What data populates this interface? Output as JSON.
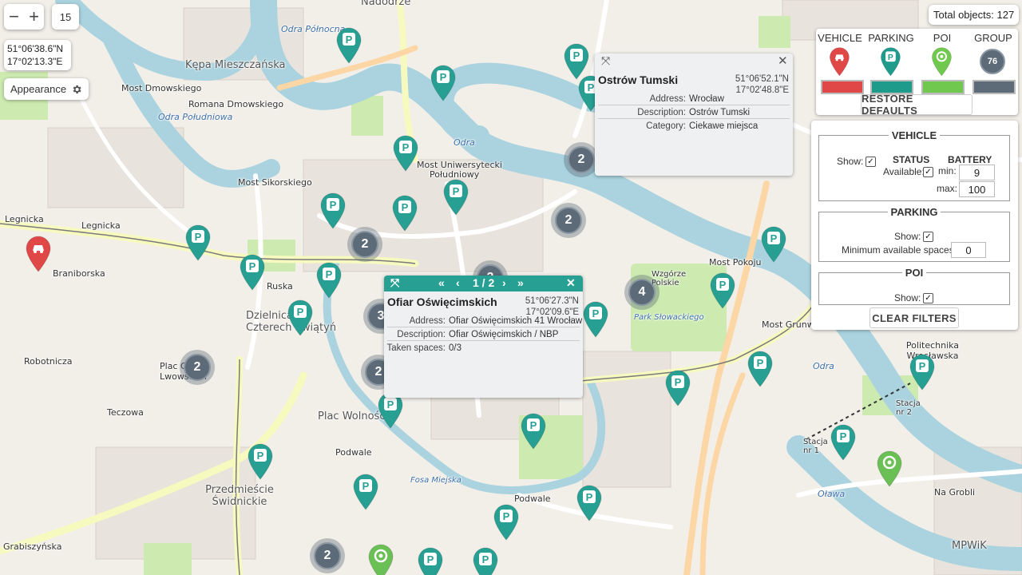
{
  "map": {
    "labels": [
      {
        "text": "Nadodrze",
        "cls": "big"
      },
      {
        "text": "Kępa Mieszczańska",
        "cls": "big"
      },
      {
        "text": "Most Dmowskiego",
        "cls": ""
      },
      {
        "text": "Romana Dmowskiego",
        "cls": ""
      },
      {
        "text": "Most Sikorskiego",
        "cls": ""
      },
      {
        "text": "Most Uniwersytecki",
        "cls": ""
      },
      {
        "text": "Południowy",
        "cls": ""
      },
      {
        "text": "Legnicka",
        "cls": ""
      },
      {
        "text": "Legnicka",
        "cls": ""
      },
      {
        "text": "Braniborska",
        "cls": ""
      },
      {
        "text": "Ruska",
        "cls": ""
      },
      {
        "text": "Dzielnica Czterech Świątyń",
        "cls": "big"
      },
      {
        "text": "Plac Orląt Lwowskich",
        "cls": ""
      },
      {
        "text": "Plac Wolności",
        "cls": "big"
      },
      {
        "text": "Przedmieście Świdnickie",
        "cls": "big"
      },
      {
        "text": "Most Pokoju",
        "cls": ""
      },
      {
        "text": "Most Grunwaldzki",
        "cls": ""
      },
      {
        "text": "Politechnika Wrocławska",
        "cls": ""
      },
      {
        "text": "Wzgórze Polskie",
        "cls": ""
      },
      {
        "text": "Park Słowackiego",
        "cls": "water"
      },
      {
        "text": "Odra",
        "cls": "water"
      },
      {
        "text": "Odra",
        "cls": "water"
      },
      {
        "text": "Odra Południowa",
        "cls": "water"
      },
      {
        "text": "Odra Północna",
        "cls": "water"
      },
      {
        "text": "Fosa Miejska",
        "cls": "water"
      },
      {
        "text": "Oława",
        "cls": "water"
      },
      {
        "text": "Na Grobli",
        "cls": ""
      },
      {
        "text": "Stacja nr 1",
        "cls": ""
      },
      {
        "text": "Stacja nr 2",
        "cls": ""
      },
      {
        "text": "MPWiK",
        "cls": "big"
      },
      {
        "text": "Grabiszyńska",
        "cls": ""
      },
      {
        "text": "Podwale",
        "cls": ""
      },
      {
        "text": "Podwale",
        "cls": ""
      },
      {
        "text": "Teczowa",
        "cls": ""
      },
      {
        "text": "Robotnicza",
        "cls": ""
      }
    ],
    "clusters": [
      "2",
      "2",
      "2",
      "2",
      "4",
      "2",
      "2",
      "2",
      "3"
    ],
    "colors": {
      "parking": "#27a093",
      "poi": "#6abf55",
      "vehicle": "#e04848",
      "group": "#5d6b78"
    }
  },
  "controls": {
    "zoom_out": "−",
    "zoom_in": "+",
    "zoom_level": "15",
    "coord_lat": "51°06'38.6\"N",
    "coord_lon": "17°02'13.3\"E",
    "appearance_label": "Appearance",
    "appearance_icon": "gear-icon",
    "total_objects": "Total objects: 127"
  },
  "legend": {
    "vehicle": "VEHICLE",
    "parking": "PARKING",
    "poi": "POI",
    "group": "GROUP",
    "group_count": "76",
    "colors": {
      "vehicle": "#e04848",
      "parking": "#1f9b8c",
      "poi": "#70c94e",
      "group": "#5d6b78"
    },
    "restore": "RESTORE DEFAULTS"
  },
  "filters": {
    "vehicle": {
      "legend": "VEHICLE",
      "show": "Show:",
      "show_checked": true,
      "status": "STATUS",
      "available": "Available:",
      "available_checked": true,
      "battery": "BATTERY",
      "min_label": "min:",
      "min": "9",
      "max_label": "max:",
      "max": "100"
    },
    "parking": {
      "legend": "PARKING",
      "show": "Show:",
      "show_checked": true,
      "min_spaces_label": "Minimum available spaces:",
      "min_spaces": "0"
    },
    "poi": {
      "legend": "POI",
      "show": "Show:",
      "show_checked": true
    },
    "clear": "CLEAR FILTERS"
  },
  "popup_poi": {
    "title": "Ostrów Tumski",
    "lat": "51°06'52.1\"N",
    "lon": "17°02'48.8\"E",
    "address_label": "Address:",
    "address": "Wrocław",
    "description_label": "Description:",
    "description": "Ostrów Tumski",
    "category_label": "Category:",
    "category": "Ciekawe miejsca"
  },
  "popup_parking": {
    "pager": "1 / 2",
    "title": "Ofiar Oświęcimskich",
    "lat": "51°06'27.3\"N",
    "lon": "17°02'09.6\"E",
    "address_label": "Address:",
    "address": "Ofiar Oświęcimskich 41 Wrocław",
    "description_label": "Description:",
    "description": "Ofiar Oświęcimskich / NBP",
    "taken_label": "Taken spaces:",
    "taken": "0/3"
  }
}
